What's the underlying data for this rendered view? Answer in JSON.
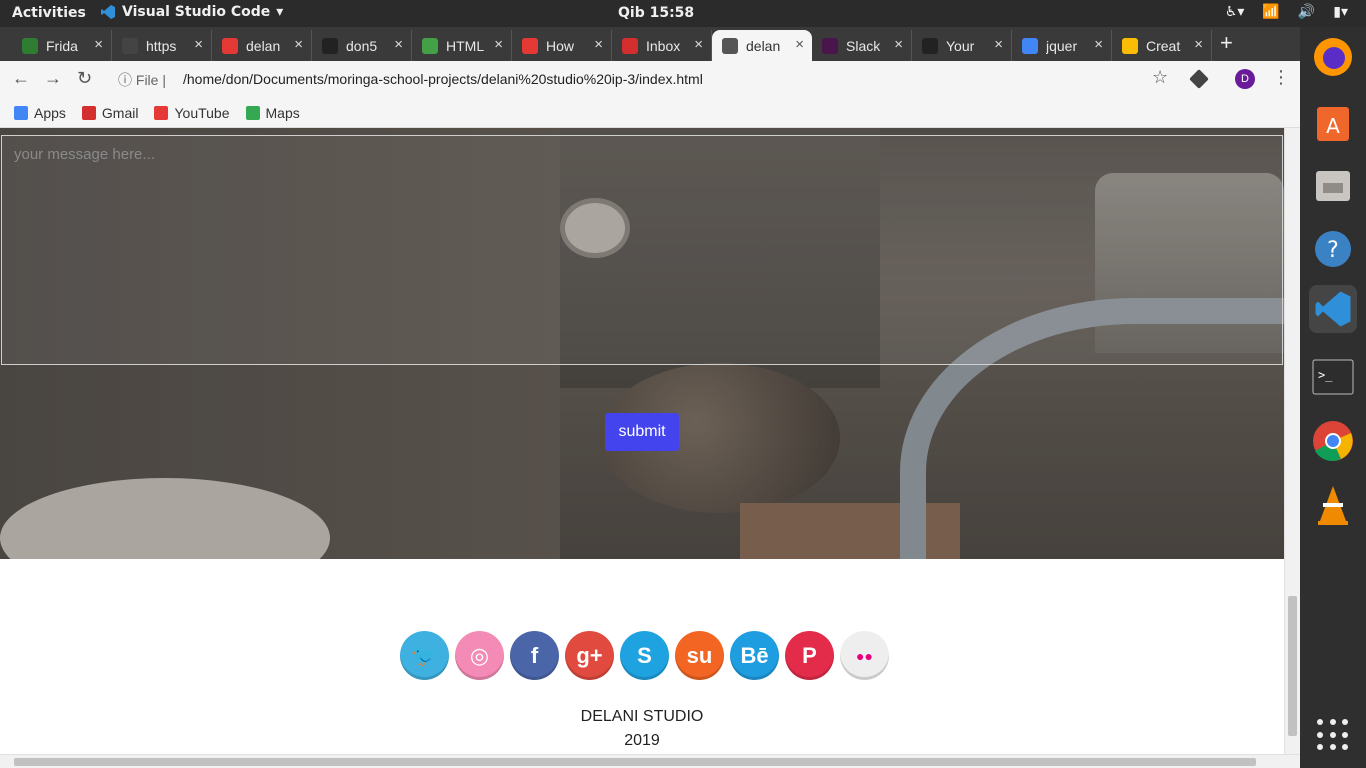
{
  "topbar": {
    "activities": "Activities",
    "app_name": "Visual Studio Code",
    "clock": "Qib 15:58"
  },
  "tabs": [
    {
      "title": "Frida",
      "color": "#2e7d32"
    },
    {
      "title": "https",
      "color": "#444"
    },
    {
      "title": "delan",
      "color": "#e53935"
    },
    {
      "title": "don5",
      "color": "#222"
    },
    {
      "title": "HTML",
      "color": "#43a047"
    },
    {
      "title": "How",
      "color": "#e53935"
    },
    {
      "title": "Inbox",
      "color": "#d32f2f"
    },
    {
      "title": "delan",
      "color": "#555",
      "active": true
    },
    {
      "title": "Slack",
      "color": "#4a154b"
    },
    {
      "title": "Your",
      "color": "#222"
    },
    {
      "title": "jquer",
      "color": "#4285f4"
    },
    {
      "title": "Creat",
      "color": "#fbbc05"
    }
  ],
  "toolbar": {
    "info_label": "File",
    "url": "/home/don/Documents/moringa-school-projects/delani%20studio%20ip-3/index.html",
    "avatar_letter": "D"
  },
  "bookmarks": [
    {
      "label": "Apps",
      "color": "#4285f4"
    },
    {
      "label": "Gmail",
      "color": "#d32f2f"
    },
    {
      "label": "YouTube",
      "color": "#e53935"
    },
    {
      "label": "Maps",
      "color": "#34a853"
    }
  ],
  "page": {
    "message_placeholder": "your message here...",
    "submit_label": "submit",
    "social": [
      {
        "name": "twitter",
        "color": "#3fb1e0",
        "glyph": "🐦"
      },
      {
        "name": "dribbble",
        "color": "#f48bb6",
        "glyph": "◎"
      },
      {
        "name": "facebook",
        "color": "#4a66a8",
        "glyph": "f"
      },
      {
        "name": "google-plus",
        "color": "#e04a3f",
        "glyph": "g+"
      },
      {
        "name": "skype",
        "color": "#1fa2e0",
        "glyph": "S"
      },
      {
        "name": "stumbleupon",
        "color": "#f26522",
        "glyph": "su"
      },
      {
        "name": "behance",
        "color": "#1e9de0",
        "glyph": "Bē"
      },
      {
        "name": "pinterest",
        "color": "#e32b4a",
        "glyph": "P"
      },
      {
        "name": "flickr",
        "color": "#eeeeee",
        "glyph": "●●"
      }
    ],
    "footer_name": "DELANI STUDIO",
    "footer_year": "2019"
  }
}
